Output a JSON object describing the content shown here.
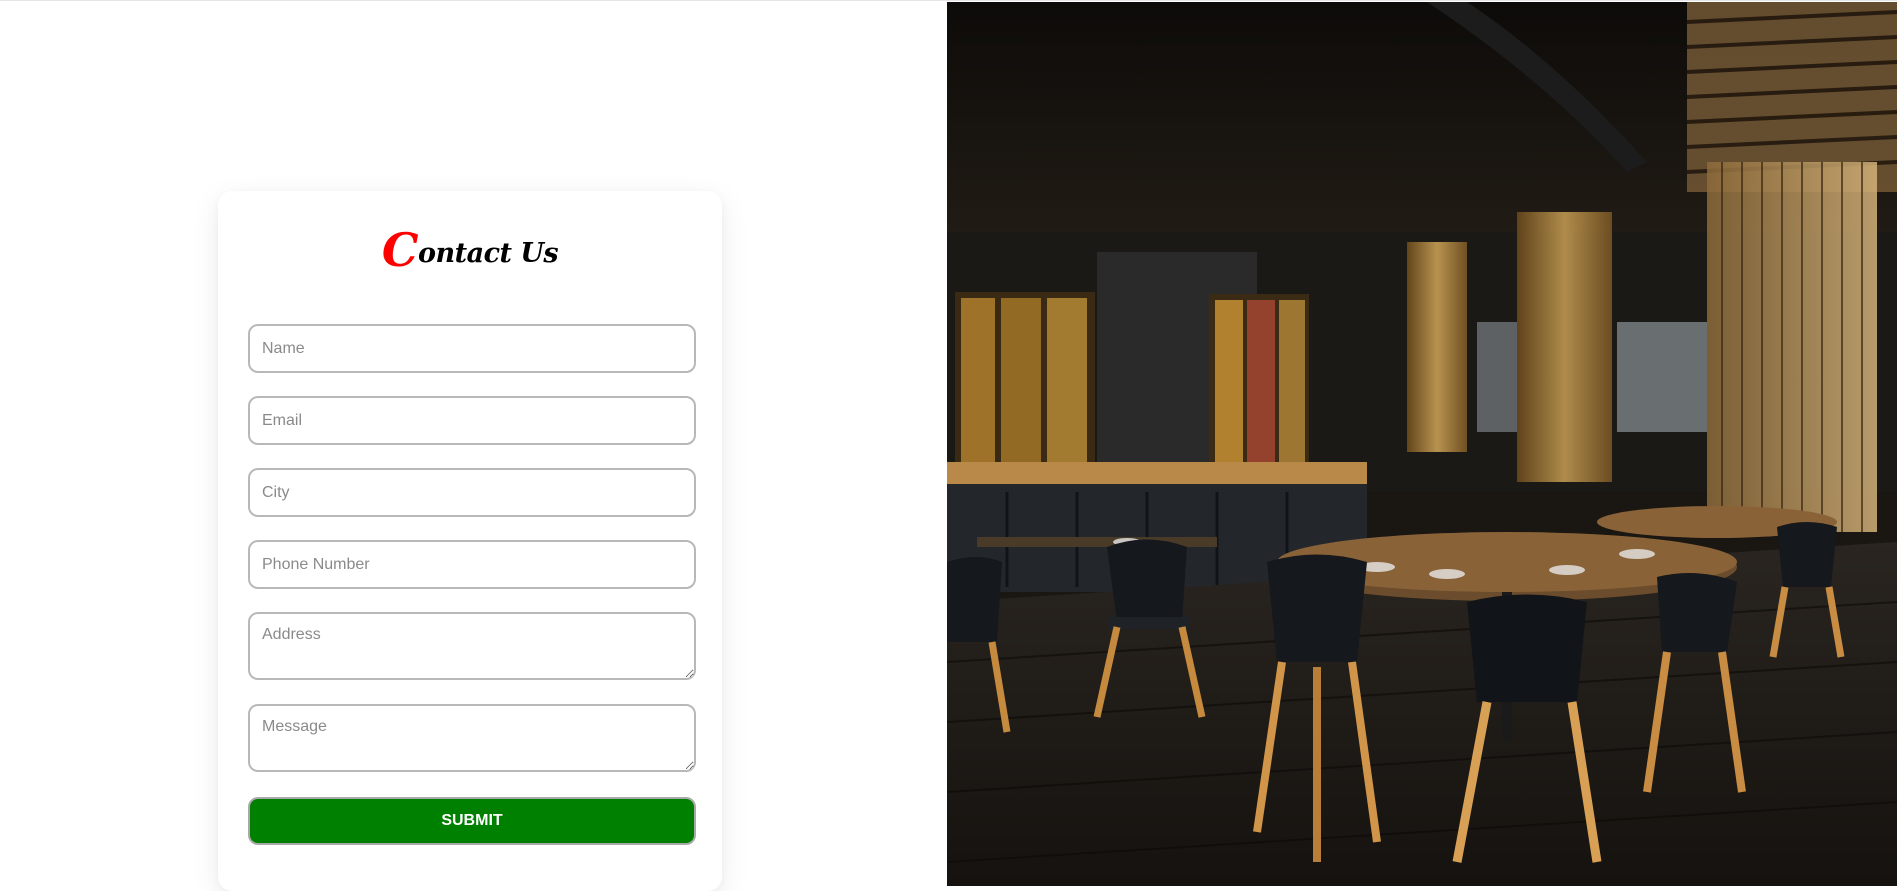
{
  "form": {
    "title_first_letter": "C",
    "title_rest": "ontact Us",
    "fields": {
      "name": {
        "placeholder": "Name",
        "value": ""
      },
      "email": {
        "placeholder": "Email",
        "value": ""
      },
      "city": {
        "placeholder": "City",
        "value": ""
      },
      "phone": {
        "placeholder": "Phone Number",
        "value": ""
      },
      "address": {
        "placeholder": "Address",
        "value": ""
      },
      "message": {
        "placeholder": "Message",
        "value": ""
      }
    },
    "submit_label": "SUBMIT"
  },
  "hero_image": {
    "subject": "restaurant-interior",
    "icon": "photo-icon"
  },
  "colors": {
    "title_accent": "#ff0000",
    "submit_bg": "#008000",
    "submit_text": "#ffffff",
    "field_border": "#b8b8b8"
  }
}
